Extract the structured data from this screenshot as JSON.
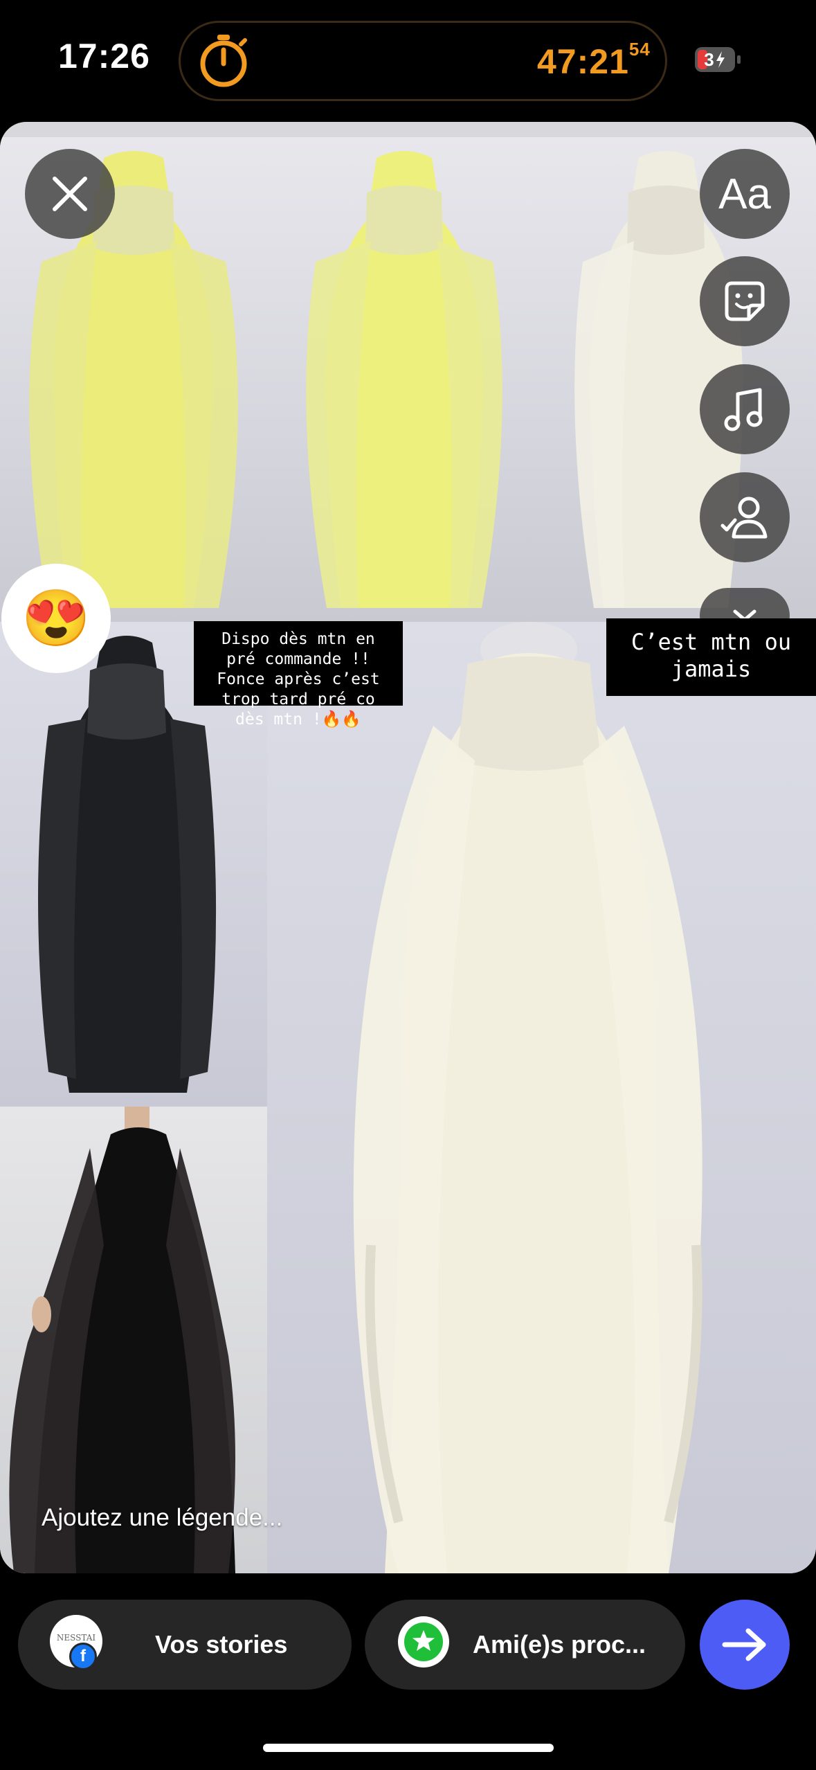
{
  "status_bar": {
    "time": "17:26",
    "timer_main": "47:21",
    "timer_seconds": "54",
    "timer_color": "#f29b20",
    "battery_label": "3"
  },
  "story": {
    "caption_1": "Dispo dès mtn en\npré commande !!\nFonce après c’est\ntrop tard pré co\ndès mtn !🔥🔥",
    "caption_2": "C’est mtn ou\njamais",
    "emoji": "😍",
    "caption_placeholder": "Ajoutez une légende..."
  },
  "tools": {
    "text_label": "Aa",
    "close_icon": "close-icon",
    "sticker_icon": "sticker-icon",
    "music_icon": "music-icon",
    "mention_icon": "mention-icon",
    "more_icon": "chevron-down-icon"
  },
  "bottom_bar": {
    "your_stories_label": "Vos stories",
    "close_friends_label": "Ami(e)s proc...",
    "avatar_text": "NESSTAI",
    "send_color": "#4c5cf5"
  }
}
